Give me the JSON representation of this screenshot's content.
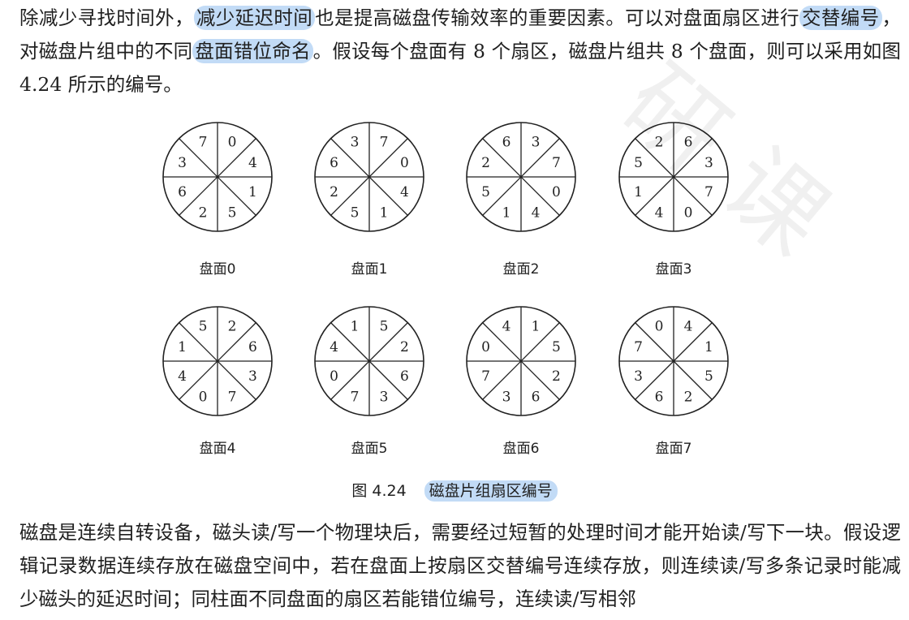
{
  "paragraph1": {
    "part1": "除减少寻找时间外，",
    "highlight1": "减少延迟时间",
    "part2": "也是提高磁盘传输效率的重要因素。可以对盘面扇区进行",
    "highlight2": "交替编号",
    "part3": "，对磁盘片组中的不同",
    "highlight3": "盘面错位命名",
    "part4": "。假设每个盘面有 8 个扇区，磁盘片组共 8 个盘面，则可以采用如图 4.24 所示的编号。"
  },
  "figure": {
    "disks": [
      {
        "label": "盘面0",
        "sectors": [
          "0",
          "4",
          "1",
          "5",
          "2",
          "6",
          "3",
          "7"
        ]
      },
      {
        "label": "盘面1",
        "sectors": [
          "7",
          "0",
          "4",
          "1",
          "5",
          "2",
          "6",
          "3"
        ]
      },
      {
        "label": "盘面2",
        "sectors": [
          "3",
          "7",
          "0",
          "4",
          "1",
          "5",
          "2",
          "6"
        ]
      },
      {
        "label": "盘面3",
        "sectors": [
          "6",
          "3",
          "7",
          "0",
          "4",
          "1",
          "5",
          "2"
        ]
      },
      {
        "label": "盘面4",
        "sectors": [
          "2",
          "6",
          "3",
          "7",
          "0",
          "4",
          "1",
          "5"
        ]
      },
      {
        "label": "盘面5",
        "sectors": [
          "5",
          "2",
          "6",
          "3",
          "7",
          "0",
          "4",
          "1"
        ]
      },
      {
        "label": "盘面6",
        "sectors": [
          "1",
          "5",
          "2",
          "6",
          "3",
          "7",
          "0",
          "4"
        ]
      },
      {
        "label": "盘面7",
        "sectors": [
          "4",
          "1",
          "5",
          "2",
          "6",
          "3",
          "7",
          "0"
        ]
      }
    ],
    "caption_number": "图 4.24",
    "caption_text": "磁盘片组扇区编号"
  },
  "paragraph2": {
    "text": "磁盘是连续自转设备，磁头读/写一个物理块后，需要经过短暂的处理时间才能开始读/写下一块。假设逻辑记录数据连续存放在磁盘空间中，若在盘面上按扇区交替编号连续存放，则连续读/写多条记录时能减少磁头的延迟时间；同柱面不同盘面的扇区若能错位编号，连续读/写相邻"
  },
  "watermark": {
    "text": "研课"
  },
  "colors": {
    "highlight": "#78afeb",
    "text": "#1f1f1f"
  }
}
